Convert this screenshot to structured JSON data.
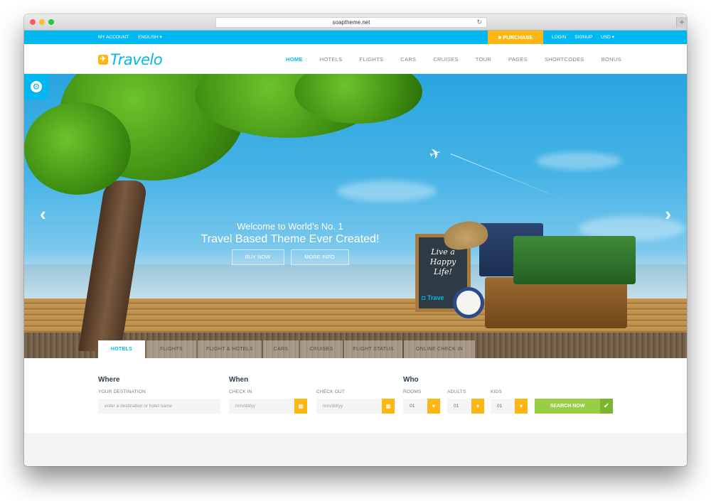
{
  "browser": {
    "url": "soaptheme.net",
    "reload_icon": "↻",
    "new_tab_icon": "+"
  },
  "topbar": {
    "my_account": "MY ACCOUNT",
    "language": "ENGLISH ▾",
    "purchase": "PURCHASE",
    "purchase_icon": "■",
    "login": "LOGIN",
    "signup": "SIGNUP",
    "currency": "USD ▾"
  },
  "header": {
    "logo_text": "Travelo",
    "logo_icon": "✈",
    "nav": [
      {
        "label": "HOME",
        "active": true
      },
      {
        "label": "HOTELS"
      },
      {
        "label": "FLIGHTS"
      },
      {
        "label": "CARS"
      },
      {
        "label": "CRUISES"
      },
      {
        "label": "TOUR"
      },
      {
        "label": "PAGES"
      },
      {
        "label": "SHORTCODES"
      },
      {
        "label": "BONUS"
      }
    ]
  },
  "hero": {
    "line1": "Welcome to World’s No. 1",
    "line2": "Travel Based Theme Ever Created!",
    "buy_now": "BUY NOW",
    "more_info": "MORE INFO",
    "prev_icon": "‹",
    "next_icon": "›",
    "settings_icon": "⚙",
    "chalkboard_text": [
      "Live a",
      "Happy",
      "Life!"
    ],
    "chalkboard_logo": "◘ Trave"
  },
  "search_tabs": [
    {
      "label": "HOTELS",
      "active": true
    },
    {
      "label": "FLIGHTS"
    },
    {
      "label": "FLIGHT & HOTELS"
    },
    {
      "label": "CARS"
    },
    {
      "label": "CRUISES"
    },
    {
      "label": "FLIGHT STATUS"
    },
    {
      "label": "ONLINE CHECK IN"
    }
  ],
  "search_form": {
    "where": {
      "title": "Where",
      "label": "YOUR DESTINATION",
      "placeholder": "enter a destination or hotel name"
    },
    "when": {
      "title": "When",
      "check_in_label": "CHECK IN",
      "check_in_placeholder": "mm/dd/yy",
      "check_out_label": "CHECK OUT",
      "check_out_placeholder": "mm/dd/yy",
      "calendar_icon": "▦"
    },
    "who": {
      "title": "Who",
      "rooms_label": "ROOMS",
      "rooms_value": "01",
      "adults_label": "ADULTS",
      "adults_value": "01",
      "kids_label": "KIDS",
      "kids_value": "01",
      "dropdown_icon": "▾"
    },
    "search_button": "SEARCH NOW",
    "search_check_icon": "✔"
  },
  "colors": {
    "accent": "#01b7f2",
    "purchase": "#fdb714",
    "search_green": "#98ce44"
  }
}
